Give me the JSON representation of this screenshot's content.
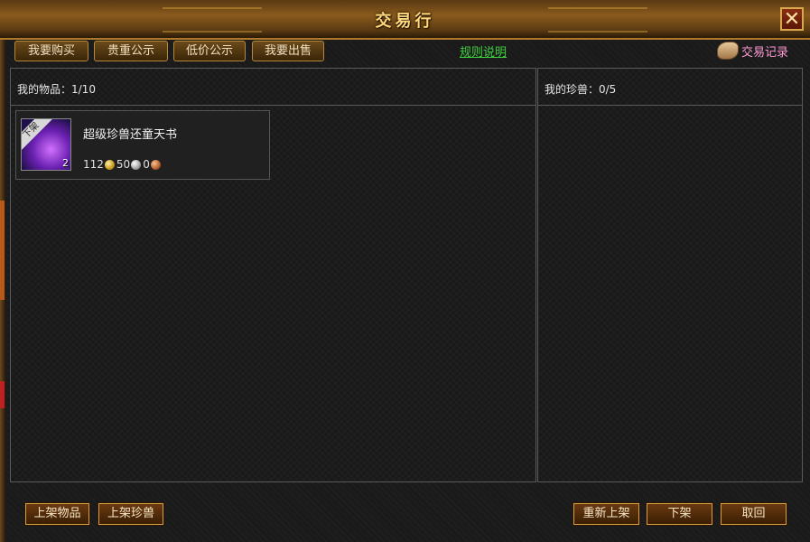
{
  "window": {
    "title": "交易行",
    "close_icon": "close-icon"
  },
  "tabs": [
    {
      "label": "我要购买"
    },
    {
      "label": "贵重公示"
    },
    {
      "label": "低价公示"
    },
    {
      "label": "我要出售"
    }
  ],
  "rules_link": "规则说明",
  "trade_record": "交易记录",
  "left_panel": {
    "header": "我的物品：1/10",
    "items": [
      {
        "name": "超级珍兽还童天书",
        "badge": "下架",
        "count": "2",
        "price": {
          "gold": "112",
          "silver": "50",
          "copper": "0"
        }
      }
    ]
  },
  "right_panel": {
    "header": "我的珍兽：0/5"
  },
  "buttons": {
    "list_item": "上架物品",
    "list_pet": "上架珍兽",
    "relist": "重新上架",
    "delist": "下架",
    "cancel": "取回"
  },
  "colors": {
    "accent": "#ffd97a",
    "link": "#3ed03e",
    "record": "#ff9ad2",
    "frame": "#b88838"
  }
}
